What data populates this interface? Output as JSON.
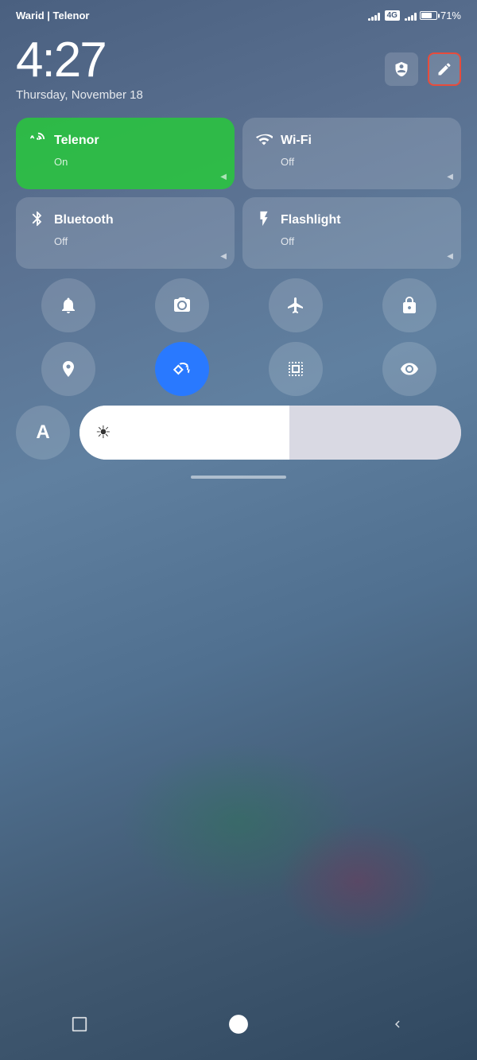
{
  "statusBar": {
    "carrier": "Warid | Telenor",
    "networkType": "4G",
    "batteryPercent": "71%"
  },
  "timeArea": {
    "time": "4:27",
    "date": "Thursday, November 18",
    "editLabel": "✎"
  },
  "tiles": [
    {
      "id": "telenor",
      "title": "Telenor",
      "status": "On",
      "icon": "signal",
      "active": true
    },
    {
      "id": "wifi",
      "title": "Wi-Fi",
      "status": "Off",
      "icon": "wifi",
      "active": false
    },
    {
      "id": "bluetooth",
      "title": "Bluetooth",
      "status": "Off",
      "icon": "bluetooth",
      "active": false
    },
    {
      "id": "flashlight",
      "title": "Flashlight",
      "status": "Off",
      "icon": "flashlight",
      "active": false
    }
  ],
  "iconButtons": [
    {
      "id": "bell",
      "icon": "bell",
      "label": "Silent Mode",
      "active": false
    },
    {
      "id": "screenshot",
      "icon": "screenshot",
      "label": "Screenshot",
      "active": false
    },
    {
      "id": "airplane",
      "icon": "airplane",
      "label": "Airplane Mode",
      "active": false
    },
    {
      "id": "lock",
      "icon": "lock",
      "label": "Screen Lock",
      "active": false
    },
    {
      "id": "location",
      "icon": "location",
      "label": "Location",
      "active": false
    },
    {
      "id": "autorotate",
      "icon": "autorotate",
      "label": "Auto Rotate",
      "active": true
    },
    {
      "id": "scan",
      "icon": "scan",
      "label": "Scan",
      "active": false
    },
    {
      "id": "eye",
      "icon": "eye",
      "label": "Reading Mode",
      "active": false
    }
  ],
  "bottomRow": {
    "fontLabel": "A",
    "brightnessIcon": "☀",
    "brightnessValue": 55
  },
  "navBar": {
    "backLabel": "◀",
    "homeLabel": "○",
    "recentLabel": "□"
  }
}
